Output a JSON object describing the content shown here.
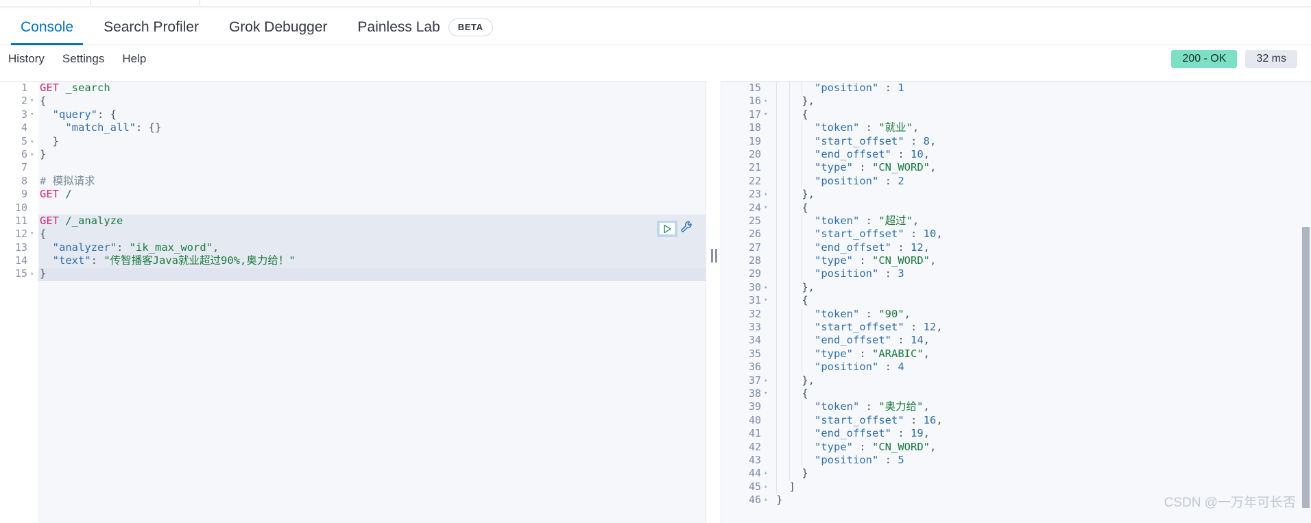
{
  "app": {
    "name": "Kibana Dev Tools Console"
  },
  "tabs": [
    {
      "label": "Console",
      "active": true
    },
    {
      "label": "Search Profiler",
      "active": false
    },
    {
      "label": "Grok Debugger",
      "active": false
    },
    {
      "label": "Painless Lab",
      "active": false,
      "badge": "BETA"
    }
  ],
  "subnav": {
    "items": [
      "History",
      "Settings",
      "Help"
    ]
  },
  "status": {
    "code": "200 - OK",
    "time": "32 ms",
    "ok_color": "#7ddfc3",
    "time_color": "#e6e8f0"
  },
  "request": {
    "lines": [
      {
        "n": "1",
        "fold": "",
        "state": "plain",
        "tokens": [
          {
            "t": "GET",
            "c": "k-method"
          },
          {
            "t": " ",
            "c": "k-punct"
          },
          {
            "t": "_search",
            "c": "k-url"
          }
        ]
      },
      {
        "n": "2",
        "fold": "▾",
        "state": "plain",
        "tokens": [
          {
            "t": "{",
            "c": "k-punct"
          }
        ]
      },
      {
        "n": "3",
        "fold": "▾",
        "state": "plain",
        "tokens": [
          {
            "t": "  ",
            "c": "k-punct"
          },
          {
            "t": "\"query\"",
            "c": "k-key"
          },
          {
            "t": ": {",
            "c": "k-punct"
          }
        ]
      },
      {
        "n": "4",
        "fold": "",
        "state": "plain",
        "tokens": [
          {
            "t": "    ",
            "c": "k-punct"
          },
          {
            "t": "\"match_all\"",
            "c": "k-key"
          },
          {
            "t": ": {}",
            "c": "k-punct"
          }
        ]
      },
      {
        "n": "5",
        "fold": "▴",
        "state": "plain",
        "tokens": [
          {
            "t": "  }",
            "c": "k-punct"
          }
        ]
      },
      {
        "n": "6",
        "fold": "▴",
        "state": "plain",
        "tokens": [
          {
            "t": "}",
            "c": "k-punct"
          }
        ]
      },
      {
        "n": "7",
        "fold": "",
        "state": "plain",
        "tokens": []
      },
      {
        "n": "8",
        "fold": "",
        "state": "plain",
        "tokens": [
          {
            "t": "# 模拟请求",
            "c": "k-cmt"
          }
        ]
      },
      {
        "n": "9",
        "fold": "",
        "state": "plain",
        "tokens": [
          {
            "t": "GET",
            "c": "k-method"
          },
          {
            "t": " ",
            "c": "k-punct"
          },
          {
            "t": "/",
            "c": "k-url"
          }
        ]
      },
      {
        "n": "10",
        "fold": "",
        "state": "plain",
        "tokens": []
      },
      {
        "n": "11",
        "fold": "",
        "state": "sel",
        "tokens": [
          {
            "t": "GET",
            "c": "k-method"
          },
          {
            "t": " ",
            "c": "k-punct"
          },
          {
            "t": "/_analyze",
            "c": "k-url"
          }
        ]
      },
      {
        "n": "12",
        "fold": "▾",
        "state": "sel",
        "tokens": [
          {
            "t": "{",
            "c": "k-punct"
          }
        ]
      },
      {
        "n": "13",
        "fold": "",
        "state": "sel",
        "tokens": [
          {
            "t": "  ",
            "c": "k-punct"
          },
          {
            "t": "\"analyzer\"",
            "c": "k-key"
          },
          {
            "t": ": ",
            "c": "k-punct"
          },
          {
            "t": "\"ik_max_word\"",
            "c": "k-str"
          },
          {
            "t": ",",
            "c": "k-punct"
          }
        ]
      },
      {
        "n": "14",
        "fold": "",
        "state": "sel",
        "tokens": [
          {
            "t": "  ",
            "c": "k-punct"
          },
          {
            "t": "\"text\"",
            "c": "k-key"
          },
          {
            "t": ": ",
            "c": "k-punct"
          },
          {
            "t": "\"传智播客Java就业超过90%,奥力给！\"",
            "c": "k-str"
          }
        ]
      },
      {
        "n": "15",
        "fold": "▴",
        "state": "cur",
        "tokens": [
          {
            "t": "}",
            "c": "k-punct"
          }
        ]
      }
    ]
  },
  "response": {
    "lines": [
      {
        "n": "15",
        "fold": "",
        "indent": 3,
        "tokens": [
          {
            "t": "      ",
            "c": "k-punct"
          },
          {
            "t": "\"position\"",
            "c": "k-key"
          },
          {
            "t": " : ",
            "c": "k-colon"
          },
          {
            "t": "1",
            "c": "k-num"
          }
        ]
      },
      {
        "n": "16",
        "fold": "▴",
        "indent": 2,
        "tokens": [
          {
            "t": "    },",
            "c": "k-punct"
          }
        ]
      },
      {
        "n": "17",
        "fold": "▾",
        "indent": 2,
        "tokens": [
          {
            "t": "    {",
            "c": "k-punct"
          }
        ]
      },
      {
        "n": "18",
        "fold": "",
        "indent": 3,
        "tokens": [
          {
            "t": "      ",
            "c": "k-punct"
          },
          {
            "t": "\"token\"",
            "c": "k-key"
          },
          {
            "t": " : ",
            "c": "k-colon"
          },
          {
            "t": "\"就业\"",
            "c": "k-str"
          },
          {
            "t": ",",
            "c": "k-punct"
          }
        ]
      },
      {
        "n": "19",
        "fold": "",
        "indent": 3,
        "tokens": [
          {
            "t": "      ",
            "c": "k-punct"
          },
          {
            "t": "\"start_offset\"",
            "c": "k-key"
          },
          {
            "t": " : ",
            "c": "k-colon"
          },
          {
            "t": "8",
            "c": "k-num"
          },
          {
            "t": ",",
            "c": "k-punct"
          }
        ]
      },
      {
        "n": "20",
        "fold": "",
        "indent": 3,
        "tokens": [
          {
            "t": "      ",
            "c": "k-punct"
          },
          {
            "t": "\"end_offset\"",
            "c": "k-key"
          },
          {
            "t": " : ",
            "c": "k-colon"
          },
          {
            "t": "10",
            "c": "k-num"
          },
          {
            "t": ",",
            "c": "k-punct"
          }
        ]
      },
      {
        "n": "21",
        "fold": "",
        "indent": 3,
        "tokens": [
          {
            "t": "      ",
            "c": "k-punct"
          },
          {
            "t": "\"type\"",
            "c": "k-key"
          },
          {
            "t": " : ",
            "c": "k-colon"
          },
          {
            "t": "\"CN_WORD\"",
            "c": "k-str"
          },
          {
            "t": ",",
            "c": "k-punct"
          }
        ]
      },
      {
        "n": "22",
        "fold": "",
        "indent": 3,
        "tokens": [
          {
            "t": "      ",
            "c": "k-punct"
          },
          {
            "t": "\"position\"",
            "c": "k-key"
          },
          {
            "t": " : ",
            "c": "k-colon"
          },
          {
            "t": "2",
            "c": "k-num"
          }
        ]
      },
      {
        "n": "23",
        "fold": "▴",
        "indent": 2,
        "tokens": [
          {
            "t": "    },",
            "c": "k-punct"
          }
        ]
      },
      {
        "n": "24",
        "fold": "▾",
        "indent": 2,
        "tokens": [
          {
            "t": "    {",
            "c": "k-punct"
          }
        ]
      },
      {
        "n": "25",
        "fold": "",
        "indent": 3,
        "tokens": [
          {
            "t": "      ",
            "c": "k-punct"
          },
          {
            "t": "\"token\"",
            "c": "k-key"
          },
          {
            "t": " : ",
            "c": "k-colon"
          },
          {
            "t": "\"超过\"",
            "c": "k-str"
          },
          {
            "t": ",",
            "c": "k-punct"
          }
        ]
      },
      {
        "n": "26",
        "fold": "",
        "indent": 3,
        "tokens": [
          {
            "t": "      ",
            "c": "k-punct"
          },
          {
            "t": "\"start_offset\"",
            "c": "k-key"
          },
          {
            "t": " : ",
            "c": "k-colon"
          },
          {
            "t": "10",
            "c": "k-num"
          },
          {
            "t": ",",
            "c": "k-punct"
          }
        ]
      },
      {
        "n": "27",
        "fold": "",
        "indent": 3,
        "tokens": [
          {
            "t": "      ",
            "c": "k-punct"
          },
          {
            "t": "\"end_offset\"",
            "c": "k-key"
          },
          {
            "t": " : ",
            "c": "k-colon"
          },
          {
            "t": "12",
            "c": "k-num"
          },
          {
            "t": ",",
            "c": "k-punct"
          }
        ]
      },
      {
        "n": "28",
        "fold": "",
        "indent": 3,
        "tokens": [
          {
            "t": "      ",
            "c": "k-punct"
          },
          {
            "t": "\"type\"",
            "c": "k-key"
          },
          {
            "t": " : ",
            "c": "k-colon"
          },
          {
            "t": "\"CN_WORD\"",
            "c": "k-str"
          },
          {
            "t": ",",
            "c": "k-punct"
          }
        ]
      },
      {
        "n": "29",
        "fold": "",
        "indent": 3,
        "tokens": [
          {
            "t": "      ",
            "c": "k-punct"
          },
          {
            "t": "\"position\"",
            "c": "k-key"
          },
          {
            "t": " : ",
            "c": "k-colon"
          },
          {
            "t": "3",
            "c": "k-num"
          }
        ]
      },
      {
        "n": "30",
        "fold": "▴",
        "indent": 2,
        "tokens": [
          {
            "t": "    },",
            "c": "k-punct"
          }
        ]
      },
      {
        "n": "31",
        "fold": "▾",
        "indent": 2,
        "tokens": [
          {
            "t": "    {",
            "c": "k-punct"
          }
        ]
      },
      {
        "n": "32",
        "fold": "",
        "indent": 3,
        "tokens": [
          {
            "t": "      ",
            "c": "k-punct"
          },
          {
            "t": "\"token\"",
            "c": "k-key"
          },
          {
            "t": " : ",
            "c": "k-colon"
          },
          {
            "t": "\"90\"",
            "c": "k-str"
          },
          {
            "t": ",",
            "c": "k-punct"
          }
        ]
      },
      {
        "n": "33",
        "fold": "",
        "indent": 3,
        "tokens": [
          {
            "t": "      ",
            "c": "k-punct"
          },
          {
            "t": "\"start_offset\"",
            "c": "k-key"
          },
          {
            "t": " : ",
            "c": "k-colon"
          },
          {
            "t": "12",
            "c": "k-num"
          },
          {
            "t": ",",
            "c": "k-punct"
          }
        ]
      },
      {
        "n": "34",
        "fold": "",
        "indent": 3,
        "tokens": [
          {
            "t": "      ",
            "c": "k-punct"
          },
          {
            "t": "\"end_offset\"",
            "c": "k-key"
          },
          {
            "t": " : ",
            "c": "k-colon"
          },
          {
            "t": "14",
            "c": "k-num"
          },
          {
            "t": ",",
            "c": "k-punct"
          }
        ]
      },
      {
        "n": "35",
        "fold": "",
        "indent": 3,
        "tokens": [
          {
            "t": "      ",
            "c": "k-punct"
          },
          {
            "t": "\"type\"",
            "c": "k-key"
          },
          {
            "t": " : ",
            "c": "k-colon"
          },
          {
            "t": "\"ARABIC\"",
            "c": "k-str"
          },
          {
            "t": ",",
            "c": "k-punct"
          }
        ]
      },
      {
        "n": "36",
        "fold": "",
        "indent": 3,
        "tokens": [
          {
            "t": "      ",
            "c": "k-punct"
          },
          {
            "t": "\"position\"",
            "c": "k-key"
          },
          {
            "t": " : ",
            "c": "k-colon"
          },
          {
            "t": "4",
            "c": "k-num"
          }
        ]
      },
      {
        "n": "37",
        "fold": "▴",
        "indent": 2,
        "tokens": [
          {
            "t": "    },",
            "c": "k-punct"
          }
        ]
      },
      {
        "n": "38",
        "fold": "▾",
        "indent": 2,
        "tokens": [
          {
            "t": "    {",
            "c": "k-punct"
          }
        ]
      },
      {
        "n": "39",
        "fold": "",
        "indent": 3,
        "tokens": [
          {
            "t": "      ",
            "c": "k-punct"
          },
          {
            "t": "\"token\"",
            "c": "k-key"
          },
          {
            "t": " : ",
            "c": "k-colon"
          },
          {
            "t": "\"奥力给\"",
            "c": "k-str"
          },
          {
            "t": ",",
            "c": "k-punct"
          }
        ]
      },
      {
        "n": "40",
        "fold": "",
        "indent": 3,
        "tokens": [
          {
            "t": "      ",
            "c": "k-punct"
          },
          {
            "t": "\"start_offset\"",
            "c": "k-key"
          },
          {
            "t": " : ",
            "c": "k-colon"
          },
          {
            "t": "16",
            "c": "k-num"
          },
          {
            "t": ",",
            "c": "k-punct"
          }
        ]
      },
      {
        "n": "41",
        "fold": "",
        "indent": 3,
        "tokens": [
          {
            "t": "      ",
            "c": "k-punct"
          },
          {
            "t": "\"end_offset\"",
            "c": "k-key"
          },
          {
            "t": " : ",
            "c": "k-colon"
          },
          {
            "t": "19",
            "c": "k-num"
          },
          {
            "t": ",",
            "c": "k-punct"
          }
        ]
      },
      {
        "n": "42",
        "fold": "",
        "indent": 3,
        "tokens": [
          {
            "t": "      ",
            "c": "k-punct"
          },
          {
            "t": "\"type\"",
            "c": "k-key"
          },
          {
            "t": " : ",
            "c": "k-colon"
          },
          {
            "t": "\"CN_WORD\"",
            "c": "k-str"
          },
          {
            "t": ",",
            "c": "k-punct"
          }
        ]
      },
      {
        "n": "43",
        "fold": "",
        "indent": 3,
        "tokens": [
          {
            "t": "      ",
            "c": "k-punct"
          },
          {
            "t": "\"position\"",
            "c": "k-key"
          },
          {
            "t": " : ",
            "c": "k-colon"
          },
          {
            "t": "5",
            "c": "k-num"
          }
        ]
      },
      {
        "n": "44",
        "fold": "▴",
        "indent": 2,
        "tokens": [
          {
            "t": "    }",
            "c": "k-punct"
          }
        ]
      },
      {
        "n": "45",
        "fold": "▴",
        "indent": 1,
        "tokens": [
          {
            "t": "  ]",
            "c": "k-punct"
          }
        ]
      },
      {
        "n": "46",
        "fold": "▴",
        "indent": 0,
        "tokens": [
          {
            "t": "}",
            "c": "k-punct"
          }
        ]
      }
    ]
  },
  "controls": {
    "play_label": "play-request",
    "wrench_label": "request-options"
  },
  "watermark": {
    "text": "CSDN @一万年可长否"
  }
}
